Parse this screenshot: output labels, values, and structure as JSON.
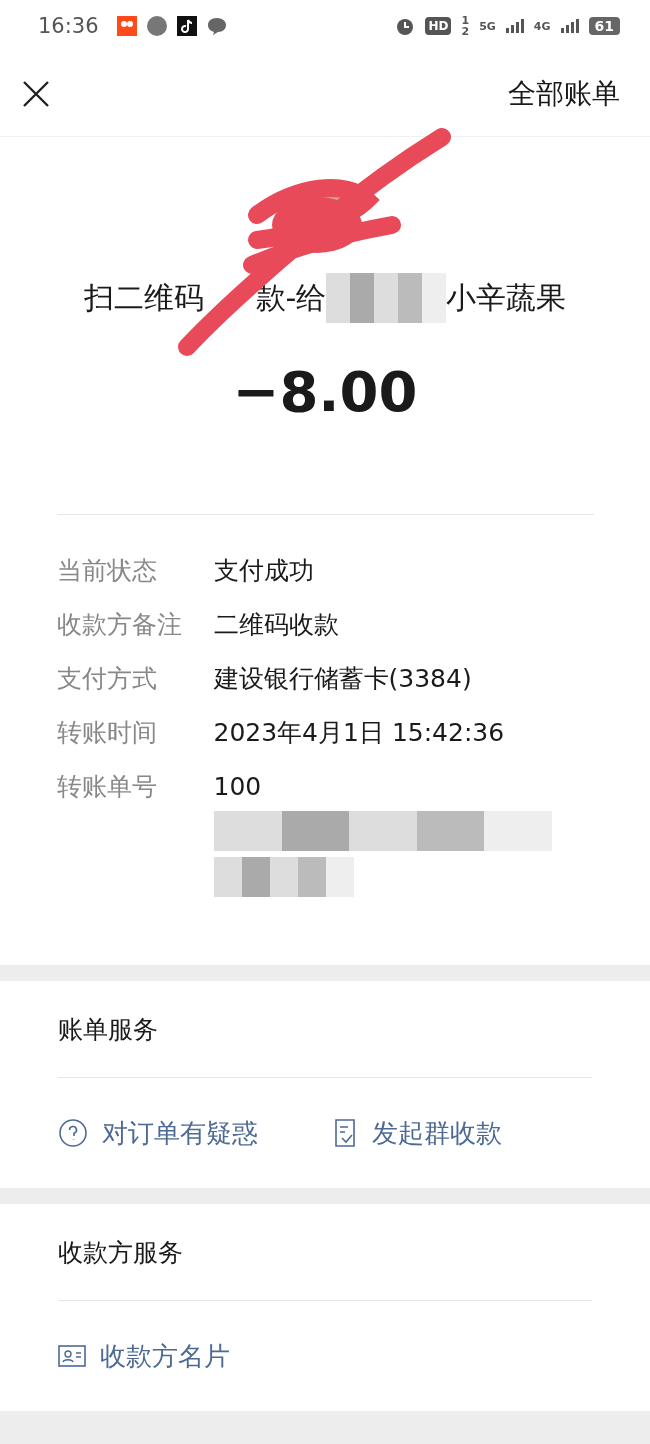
{
  "status_bar": {
    "time": "16:36",
    "hd": "HD",
    "hd_slots": [
      "1",
      "2"
    ],
    "networks": [
      "5G",
      "4G"
    ],
    "battery": "61"
  },
  "header": {
    "link": "全部账单"
  },
  "payment": {
    "title_start": "扫二维码",
    "title_prefix": "款-给",
    "title_suffix": "小辛蔬果",
    "amount": "−8.00"
  },
  "details": [
    {
      "label": "当前状态",
      "value": "支付成功",
      "redacted": false
    },
    {
      "label": "收款方备注",
      "value": "二维码收款",
      "redacted": false
    },
    {
      "label": "支付方式",
      "value": "建设银行储蓄卡(3384)",
      "redacted": false
    },
    {
      "label": "转账时间",
      "value": "2023年4月1日 15:42:36",
      "redacted": false
    },
    {
      "label": "转账单号",
      "value": "100",
      "redacted": true
    }
  ],
  "sections": [
    {
      "title": "账单服务",
      "actions": [
        {
          "label": "对订单有疑惑",
          "kind": "question"
        },
        {
          "label": "发起群收款",
          "kind": "note"
        }
      ]
    },
    {
      "title": "收款方服务",
      "actions": [
        {
          "label": "收款方名片",
          "kind": "card"
        }
      ]
    }
  ]
}
